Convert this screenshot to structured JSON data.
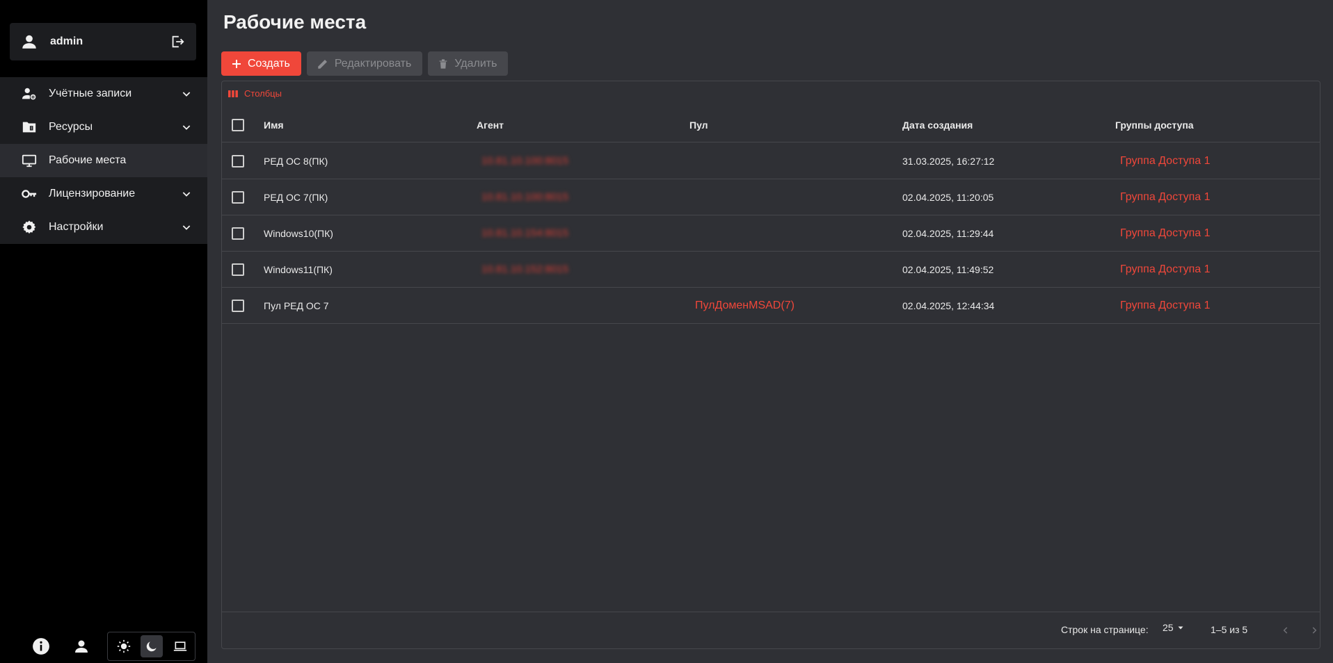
{
  "user": {
    "name": "admin"
  },
  "sidebar": {
    "items": [
      {
        "label": "Учётные записи",
        "icon": "user-cog-icon",
        "expandable": true
      },
      {
        "label": "Ресурсы",
        "icon": "folder-network-icon",
        "expandable": true
      },
      {
        "label": "Рабочие места",
        "icon": "monitor-icon",
        "expandable": false,
        "active": true
      },
      {
        "label": "Лицензирование",
        "icon": "key-icon",
        "expandable": true
      },
      {
        "label": "Настройки",
        "icon": "gear-icon",
        "expandable": true
      }
    ]
  },
  "page": {
    "title": "Рабочие места"
  },
  "toolbar": {
    "create_label": "Создать",
    "edit_label": "Редактировать",
    "delete_label": "Удалить"
  },
  "table": {
    "columns_label": "Столбцы",
    "headers": [
      "Имя",
      "Агент",
      "Пул",
      "Дата создания",
      "Группы доступа"
    ],
    "rows": [
      {
        "name": "РЕД ОС 8(ПК)",
        "agent": "10.81.10.100:8015",
        "pool": "",
        "created": "31.03.2025, 16:27:12",
        "group": "Группа Доступа 1"
      },
      {
        "name": "РЕД ОС 7(ПК)",
        "agent": "10.81.10.100:8015",
        "pool": "",
        "created": "02.04.2025, 11:20:05",
        "group": "Группа Доступа 1"
      },
      {
        "name": "Windows10(ПК)",
        "agent": "10.81.10.154:8015",
        "pool": "",
        "created": "02.04.2025, 11:29:44",
        "group": "Группа Доступа 1"
      },
      {
        "name": "Windows11(ПК)",
        "agent": "10.81.10.152:8015",
        "pool": "",
        "created": "02.04.2025, 11:49:52",
        "group": "Группа Доступа 1"
      },
      {
        "name": "Пул РЕД ОС 7",
        "agent": "",
        "pool": "ПулДоменMSAD(7)",
        "created": "02.04.2025, 12:44:34",
        "group": "Группа Доступа 1"
      }
    ]
  },
  "pagination": {
    "rows_per_page_label": "Строк на странице:",
    "rows_per_page_value": "25",
    "range_label": "1–5 из 5"
  },
  "colors": {
    "accent": "#f0473a",
    "sidebar_bg": "#000000",
    "main_bg": "#2f3035"
  }
}
